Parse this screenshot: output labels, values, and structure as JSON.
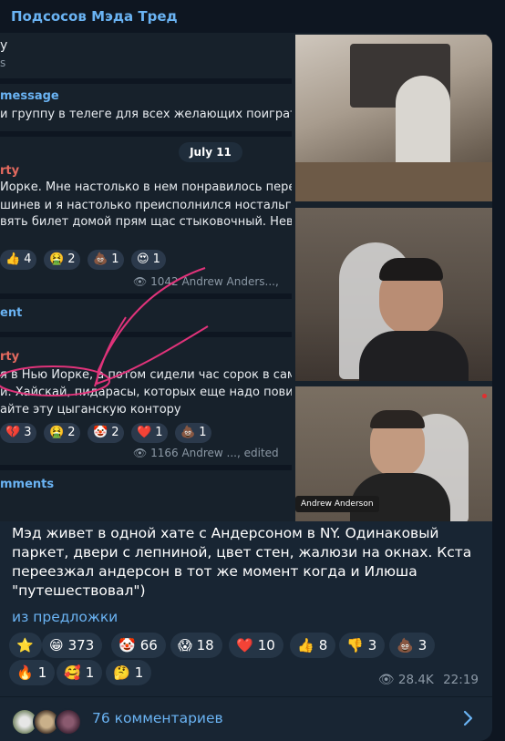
{
  "channel": {
    "name": "Подсосов Мэда Тред"
  },
  "screenshot": {
    "top_fragment": "y",
    "top_fragment2": "s",
    "pinned_title": "message",
    "pinned_text": "и группу в телеге для всех желающих поиграть",
    "date": "July 11",
    "post1": {
      "author": "rty",
      "lines": [
        "Йорке. Мне настолько в нем понравилось пере,",
        "шинев и я настолько преисполнился ностальгии",
        "вять билет домой прям щас стыковочный. Нева,"
      ],
      "reactions": [
        {
          "emoji": "👍",
          "count": "4"
        },
        {
          "emoji": "🤮",
          "count": "2"
        },
        {
          "emoji": "💩",
          "count": "1"
        },
        {
          "emoji": "😍",
          "count": "1"
        }
      ],
      "views": "1042",
      "signature": "Andrew Anders...,",
      "comments": "ent"
    },
    "post2": {
      "author": "rty",
      "lines": [
        "я в Нью Йорке, а потом сидели час сорок в само",
        "и. Хайскай, пидарасы, которых еще надо повид",
        "айте эту цыганскую контору"
      ],
      "reactions": [
        {
          "emoji": "💔",
          "count": "3"
        },
        {
          "emoji": "🤮",
          "count": "2"
        },
        {
          "emoji": "🤡",
          "count": "2"
        },
        {
          "emoji": "❤️",
          "count": "1"
        },
        {
          "emoji": "💩",
          "count": "1"
        }
      ],
      "views": "1166",
      "signature": "Andrew ..., edited",
      "comments": "mments"
    },
    "cam_label": "Andrew Anderson"
  },
  "message": {
    "text": "Мэд живет в одной хате с Андерсоном в NY. Одинаковый паркет, двери с лепниной, цвет стен, жалюзи на окнах. Кста переезжал андерсон в тот же момент когда и Илюша \"путешествовал\")",
    "source": "из предложки",
    "reactions": [
      {
        "emoji": "⭐",
        "count": ""
      },
      {
        "emoji": "😁",
        "count": "373"
      },
      {
        "emoji": "🤡",
        "count": "66"
      },
      {
        "emoji": "😱",
        "count": "18"
      },
      {
        "emoji": "❤️",
        "count": "10"
      },
      {
        "emoji": "👍",
        "count": "8"
      },
      {
        "emoji": "👎",
        "count": "3"
      },
      {
        "emoji": "💩",
        "count": "3"
      },
      {
        "emoji": "🔥",
        "count": "1"
      },
      {
        "emoji": "🥰",
        "count": "1"
      },
      {
        "emoji": "🤔",
        "count": "1"
      }
    ],
    "views": "28.4K",
    "time": "22:19",
    "comments_label": "76 комментариев"
  },
  "colors": {
    "accent": "#6ab3f3",
    "bubble": "#182533",
    "background": "#0e1621",
    "reaction_bg": "#253546"
  }
}
